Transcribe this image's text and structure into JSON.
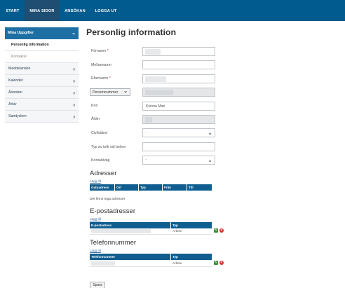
{
  "nav": {
    "items": [
      "START",
      "MINA SIDOR",
      "ANSÖKAN",
      "LOGGA UT"
    ],
    "active": "MINA SIDOR"
  },
  "sidebar": {
    "header": "Mina Uppgifter",
    "sub_items": [
      "Personlig information",
      "Kontakter"
    ],
    "items": [
      "Meddelanden",
      "Kalender",
      "Ärenden",
      "Arkiv",
      "Samtycken"
    ]
  },
  "page": {
    "title": "Personlig information"
  },
  "form": {
    "fornamn_label": "Förnamn",
    "mellannamn_label": "Mellannamn",
    "efternamn_label": "Efternamn",
    "required_mark": "*",
    "personnummer_label": "Personnummer",
    "kon_label": "Kön",
    "kon_options": "Kvinna  Man",
    "alder_label": "Ålder",
    "civilstand_label": "Civilstånd",
    "civilstand_value": "-",
    "tolk_label": "Typ av tolk vid behov",
    "kontaktvag_label": "Kontaktväg",
    "kontaktvag_value": "-"
  },
  "adresser": {
    "title": "Adresser",
    "add_link": "Lägg till",
    "columns": [
      "Gatuadress",
      "Ort",
      "Typ",
      "Från",
      "Till"
    ],
    "empty_text": "Det finns inga adresser"
  },
  "epost": {
    "title": "E-postadresser",
    "add_link": "Lägg till",
    "columns": [
      "E-postadress",
      "Typ"
    ],
    "rows": [
      {
        "type": "Arbete"
      }
    ]
  },
  "telefon": {
    "title": "Telefonnummer",
    "add_link": "Lägg till",
    "columns": [
      "Telefonnummer",
      "Typ"
    ],
    "rows": [
      {
        "type": "Arbete"
      }
    ]
  },
  "save_label": "Spara",
  "colors": {
    "nav_bg": "#005b8f",
    "nav_active": "#1f4e72",
    "sidebar_header": "#1e6fa3",
    "table_header": "#0f5e8f",
    "required": "#c0392b"
  }
}
